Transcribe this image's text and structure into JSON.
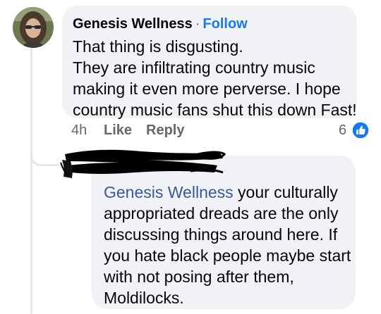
{
  "comment": {
    "author": "Genesis Wellness",
    "separator": "·",
    "follow_label": "Follow",
    "text_lines": [
      "That thing is disgusting.",
      "They are infiltrating country music",
      "making it even more perverse. I hope",
      "country music fans shut this down Fast!"
    ],
    "time": "4h",
    "like_label": "Like",
    "reply_label": "Reply",
    "reaction_count": "6",
    "reaction_icon": "like-thumb-icon"
  },
  "reply": {
    "mention": "Genesis Wellness",
    "line1_rest": " your culturally",
    "text_lines": [
      "appropriated dreads are the only",
      "discussing things around here. If",
      "you hate black people maybe start",
      "with not posing after them,",
      "Moldilocks."
    ]
  },
  "colors": {
    "bubble": "#f0f2f5",
    "link_blue": "#1877f2",
    "mention_blue": "#385898",
    "meta_gray": "#65676b"
  }
}
